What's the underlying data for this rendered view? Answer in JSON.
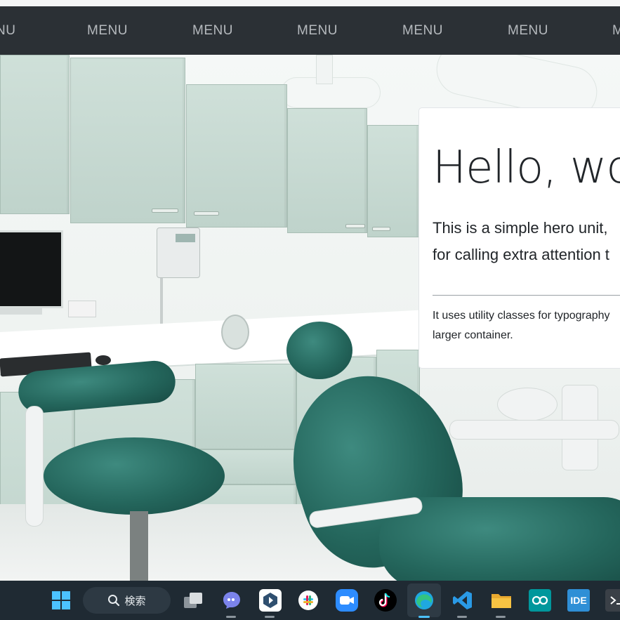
{
  "nav": {
    "items": [
      "NU",
      "MENU",
      "MENU",
      "MENU",
      "MENU",
      "MENU",
      "M"
    ]
  },
  "hero": {
    "title": "Hello, wo",
    "lead_line1": "This is a simple hero unit,",
    "lead_line2": "for calling extra attention t",
    "body_line1": "It uses utility classes for typography",
    "body_line2": "larger container."
  },
  "taskbar": {
    "search_label": "検索",
    "icons": [
      {
        "name": "windows-start-icon",
        "color": "#4cc2ff"
      },
      {
        "name": "search-icon",
        "color": "#e8ecef"
      },
      {
        "name": "task-view-icon",
        "color": "#c9cfd4"
      },
      {
        "name": "teams-chat-icon",
        "color": "#7b83eb"
      },
      {
        "name": "app-launcher-icon",
        "color": "#2f6fb5"
      },
      {
        "name": "slack-icon",
        "color": "#ffffff"
      },
      {
        "name": "zoom-icon",
        "color": "#2d8cff"
      },
      {
        "name": "tiktok-icon",
        "color": "#000000"
      },
      {
        "name": "edge-icon",
        "color": "#1fa8e0"
      },
      {
        "name": "vscode-icon",
        "color": "#2a9ae6"
      },
      {
        "name": "file-explorer-icon",
        "color": "#f6c343"
      },
      {
        "name": "arduino-icon",
        "color": "#00979c"
      },
      {
        "name": "ide-icon",
        "color": "#2f8fd6"
      },
      {
        "name": "terminal-icon",
        "color": "#3a4047"
      }
    ],
    "ide_label": "IDE"
  },
  "colors": {
    "navbar": "#2b3035",
    "nav_text": "#b5b9bd",
    "taskbar": "#1f2a33",
    "accent": "#4cc2ff",
    "teal_upholstery": "#24665c",
    "cabinet": "#c7dad2"
  }
}
